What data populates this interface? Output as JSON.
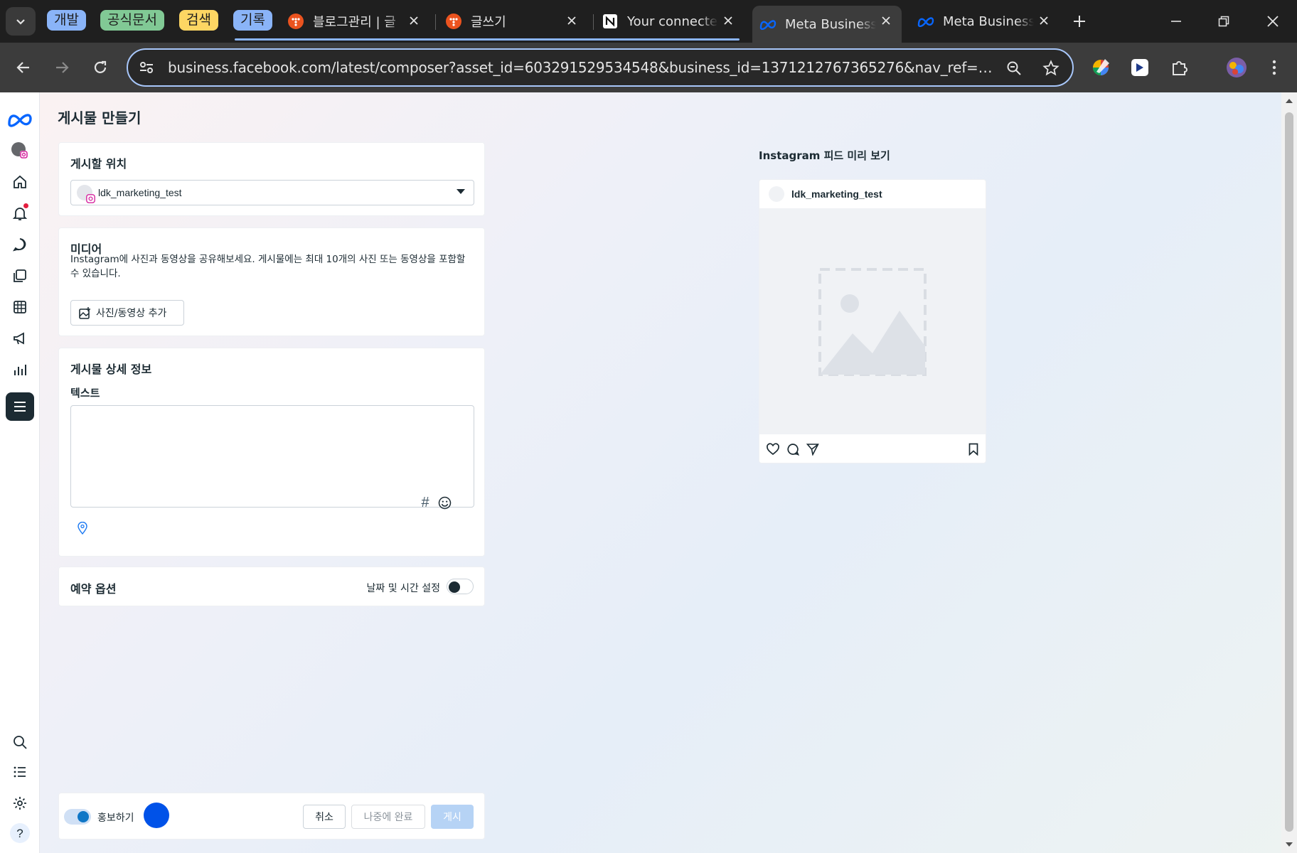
{
  "browser": {
    "tab_groups": [
      {
        "label": "개발",
        "color": "#8ab4f8"
      },
      {
        "label": "공식문서",
        "color": "#81c995"
      },
      {
        "label": "검색",
        "color": "#fdd663"
      },
      {
        "label": "기록",
        "color": "#8ab4f8"
      }
    ],
    "tabs": [
      {
        "title": "블로그관리 | 글",
        "icon": "tistory-icon",
        "active": false
      },
      {
        "title": "글쓰기",
        "icon": "tistory-icon",
        "active": false
      },
      {
        "title": "Your connected",
        "icon": "notion-icon",
        "active": false
      },
      {
        "title": "Meta Business",
        "icon": "meta-icon",
        "active": true
      },
      {
        "title": "Meta Business",
        "icon": "meta-icon",
        "active": false
      }
    ],
    "url": "business.facebook.com/latest/composer?asset_id=603291529534548&business_id=1371212767365276&nav_ref=biz_we..."
  },
  "page": {
    "title": "게시물 만들기",
    "location": {
      "title": "게시할 위치",
      "selected_account": "ldk_marketing_test"
    },
    "media": {
      "title": "미디어",
      "description": "Instagram에 사진과 동영상을 공유해보세요. 게시물에는 최대 10개의 사진 또는 동영상을 포함할 수 있습니다.",
      "add_button": "사진/동영상 추가"
    },
    "details": {
      "title": "게시물 상세 정보",
      "text_label": "텍스트",
      "text_value": ""
    },
    "schedule": {
      "title": "예약 옵션",
      "toggle_label": "날짜 및 시간 설정",
      "toggle_on": false
    },
    "preview": {
      "title": "Instagram 피드 미리 보기",
      "account": "ldk_marketing_test"
    },
    "footer": {
      "boost_label": "홍보하기",
      "boost_on": true,
      "cancel": "취소",
      "finish_later": "나중에 완료",
      "publish": "게시"
    }
  },
  "colors": {
    "meta_blue": "#0866ff",
    "primary_disabled": "#b6d3f5",
    "nav_selected": "#1c2b33"
  }
}
